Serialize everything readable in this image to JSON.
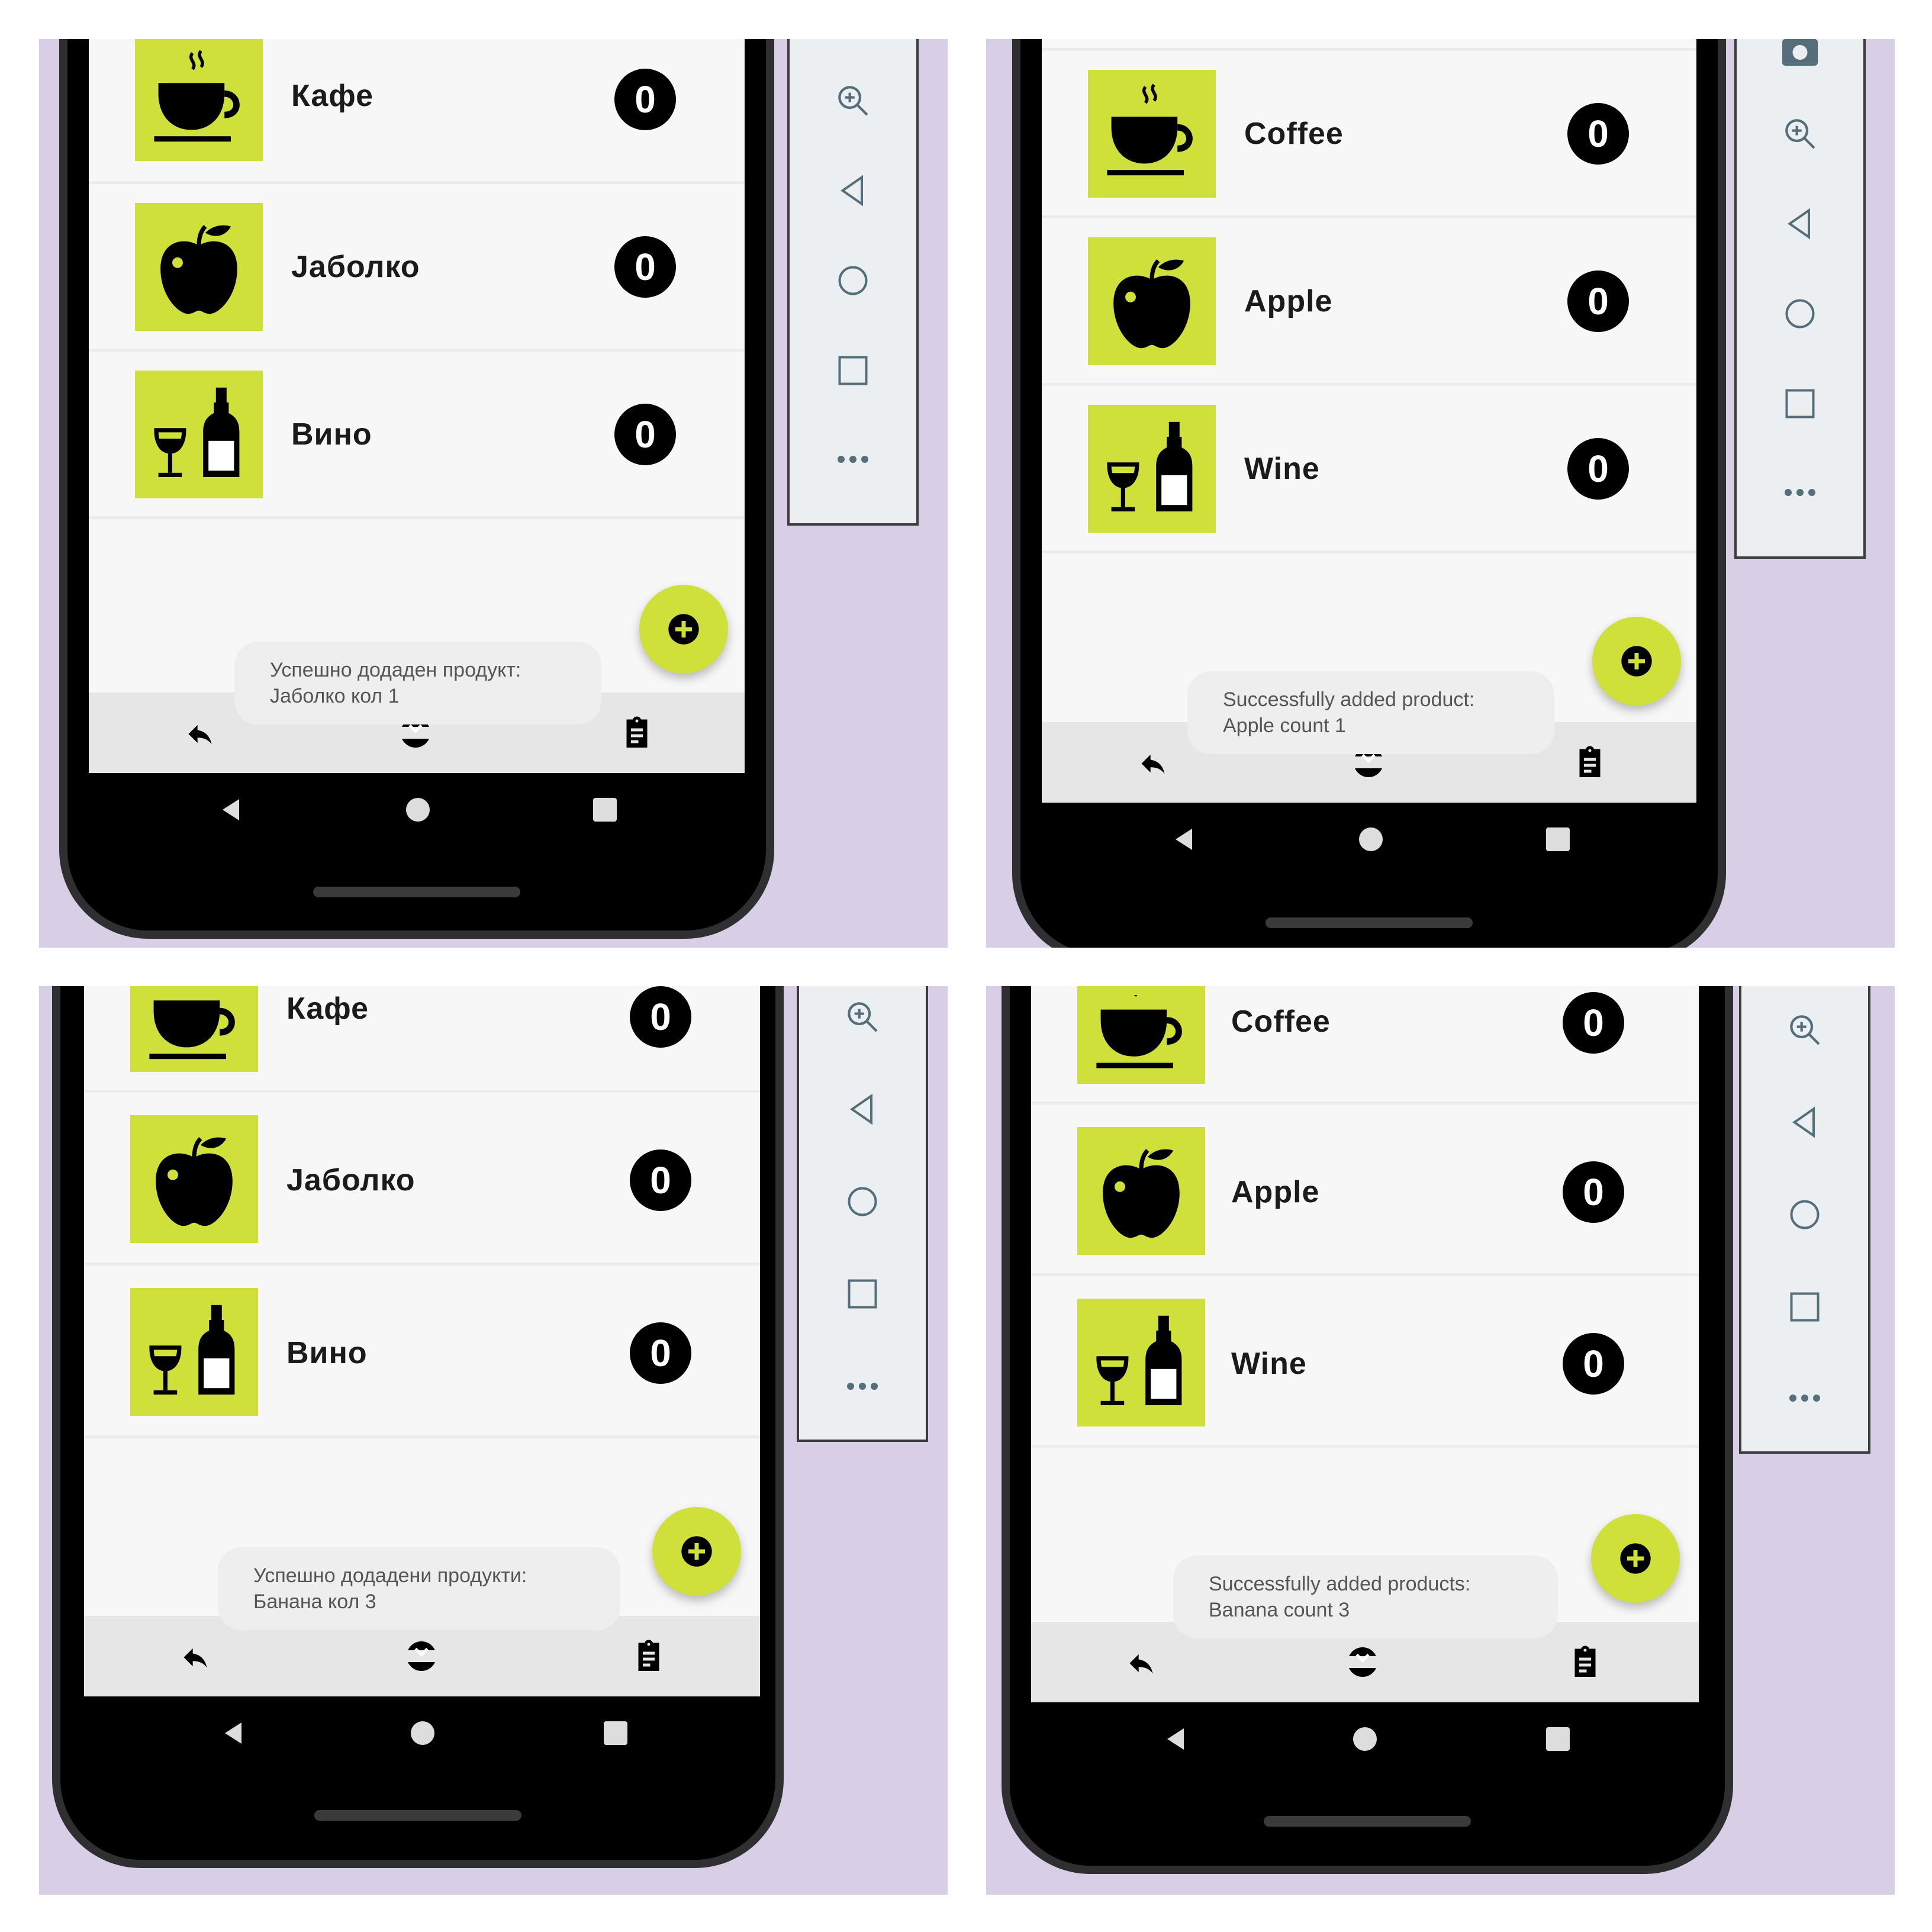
{
  "panels": [
    {
      "id": "tl",
      "items": [
        {
          "label": "Кафе",
          "count": "0",
          "icon": "coffee-cup-icon"
        },
        {
          "label": "Jаболко",
          "count": "0",
          "icon": "apple-icon"
        },
        {
          "label": "Вино",
          "count": "0",
          "icon": "wine-icon"
        }
      ],
      "toast": {
        "line1": "Успешно додаден продукт:",
        "line2": "Jаболко кол 1"
      }
    },
    {
      "id": "tr",
      "items": [
        {
          "label": "Coffee",
          "count": "0",
          "icon": "coffee-cup-icon"
        },
        {
          "label": "Apple",
          "count": "0",
          "icon": "apple-icon"
        },
        {
          "label": "Wine",
          "count": "0",
          "icon": "wine-icon"
        }
      ],
      "toast": {
        "line1": "Successfully added product:",
        "line2": "Apple count 1"
      }
    },
    {
      "id": "bl",
      "items": [
        {
          "label": "Кафе",
          "count": "0",
          "icon": "coffee-cup-icon"
        },
        {
          "label": "Jаболко",
          "count": "0",
          "icon": "apple-icon"
        },
        {
          "label": "Вино",
          "count": "0",
          "icon": "wine-icon"
        }
      ],
      "toast": {
        "line1": "Успешно додадени продукти:",
        "line2": "Банана кол 3"
      }
    },
    {
      "id": "br",
      "items": [
        {
          "label": "Coffee",
          "count": "0",
          "icon": "coffee-cup-icon"
        },
        {
          "label": "Apple",
          "count": "0",
          "icon": "apple-icon"
        },
        {
          "label": "Wine",
          "count": "0",
          "icon": "wine-icon"
        }
      ],
      "toast": {
        "line1": "Successfully added products:",
        "line2": "Banana count 3"
      }
    }
  ],
  "emulator_tools": [
    "zoom-icon",
    "back-icon",
    "home-icon",
    "overview-icon",
    "more-icon"
  ],
  "colors": {
    "accent": "#cfe03b",
    "background": "#d8cfe6",
    "list_bg": "#f7f7f7"
  }
}
